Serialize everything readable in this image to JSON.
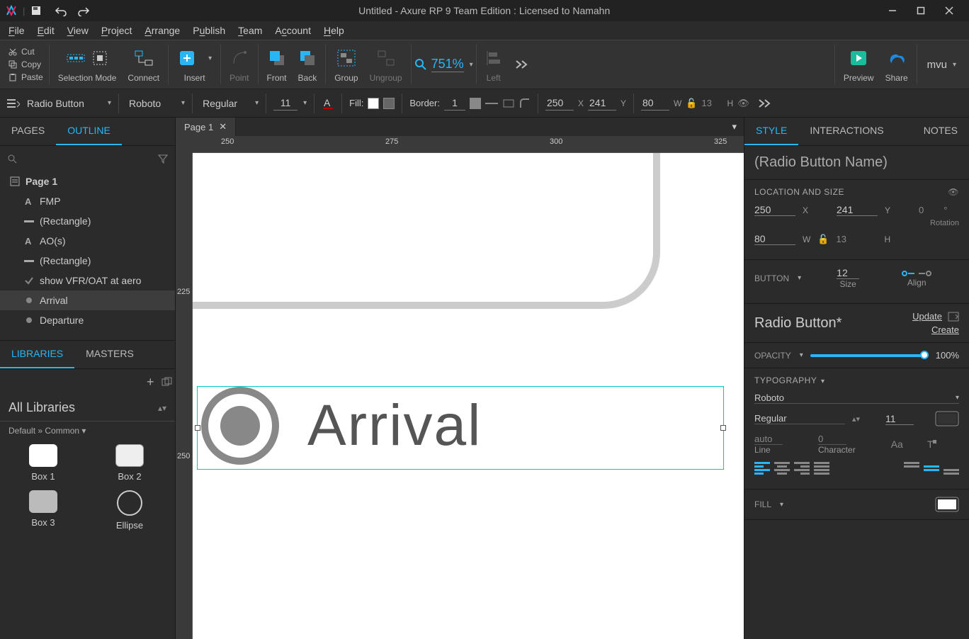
{
  "window": {
    "title": "Untitled - Axure RP 9 Team Edition : Licensed to Namahn"
  },
  "edit": {
    "cut": "Cut",
    "copy": "Copy",
    "paste": "Paste"
  },
  "menu": {
    "file": "File",
    "edit": "Edit",
    "view": "View",
    "project": "Project",
    "arrange": "Arrange",
    "publish": "Publish",
    "team": "Team",
    "account": "Account",
    "help": "Help"
  },
  "toolbar": {
    "selection_mode": "Selection Mode",
    "connect": "Connect",
    "insert": "Insert",
    "point": "Point",
    "front": "Front",
    "back": "Back",
    "group": "Group",
    "ungroup": "Ungroup",
    "left": "Left",
    "zoom": "751%",
    "preview": "Preview",
    "share": "Share",
    "user": "mvu",
    "more": ""
  },
  "format": {
    "widget_type": "Radio Button",
    "font": "Roboto",
    "weight": "Regular",
    "size": "11",
    "fill_label": "Fill:",
    "border_label": "Border:",
    "border_width": "1",
    "x": "250",
    "y": "241",
    "w": "80",
    "h": "13"
  },
  "left": {
    "tabs": {
      "pages": "PAGES",
      "outline": "OUTLINE",
      "libraries": "LIBRARIES",
      "masters": "MASTERS"
    },
    "page_root": "Page 1",
    "outline": [
      {
        "name": "FMP",
        "type": "text"
      },
      {
        "name": "(Rectangle)",
        "type": "line"
      },
      {
        "name": "AO(s)",
        "type": "text"
      },
      {
        "name": "(Rectangle)",
        "type": "line"
      },
      {
        "name": "show VFR/OAT at aero",
        "type": "check"
      },
      {
        "name": "Arrival",
        "type": "radio",
        "selected": true
      },
      {
        "name": "Departure",
        "type": "radio"
      }
    ],
    "lib_header": "All Libraries",
    "lib_crumb": "Default » Common ▾",
    "widgets": [
      {
        "label": "Box 1",
        "variant": "box1"
      },
      {
        "label": "Box 2",
        "variant": "box2"
      },
      {
        "label": "Box 3",
        "variant": "box3"
      },
      {
        "label": "Ellipse",
        "variant": "ellipse"
      }
    ]
  },
  "center": {
    "tab": "Page 1",
    "ruler_h": [
      "250",
      "275",
      "300",
      "325"
    ],
    "ruler_v": [
      "225",
      "250"
    ]
  },
  "canvas": {
    "radio_label": "Arrival"
  },
  "right": {
    "tabs": {
      "style": "STYLE",
      "interactions": "INTERACTIONS",
      "notes": "NOTES"
    },
    "name_placeholder": "(Radio Button Name)",
    "location_size": "LOCATION AND SIZE",
    "x": "250",
    "y": "241",
    "rotation": "0",
    "rotation_lbl": "Rotation",
    "w": "80",
    "h": "13",
    "button": "BUTTON",
    "button_size": "12",
    "size_lbl": "Size",
    "align_lbl": "Align",
    "style_name": "Radio Button*",
    "update": "Update",
    "create": "Create",
    "opacity": "OPACITY",
    "opacity_val": "100%",
    "typography": "TYPOGRAPHY",
    "font": "Roboto",
    "weight": "Regular",
    "font_size": "11",
    "line_val": "auto",
    "line_lbl": "Line",
    "char_val": "0",
    "char_lbl": "Character",
    "fill": "FILL"
  }
}
